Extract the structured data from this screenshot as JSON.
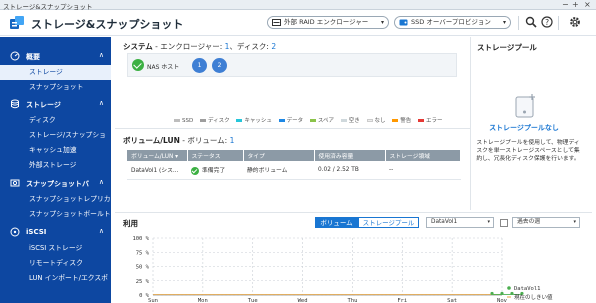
{
  "window": {
    "title": "ストレージ&スナップショット",
    "controls": [
      "−",
      "+",
      "×"
    ]
  },
  "header": {
    "app_title": "ストレージ&スナップショット",
    "raid_button": "外部 RAID エンクロージャー",
    "ssd_button": "SSD オーバープロビジョン"
  },
  "sidebar": {
    "sections": [
      {
        "label": "概要",
        "icon": "dashboard-icon",
        "items": [
          "ストレージ",
          "スナップショット"
        ]
      },
      {
        "label": "ストレージ",
        "icon": "database-icon",
        "items": [
          "ディスク",
          "ストレージ/スナップショ",
          "キャッシュ加速",
          "外部ストレージ"
        ]
      },
      {
        "label": "スナップショットバ",
        "icon": "snapshot-backup-icon",
        "items": [
          "スナップショットレプリカ",
          "スナップショットボールト"
        ]
      },
      {
        "label": "iSCSI",
        "icon": "iscsi-icon",
        "items": [
          "iSCSI ストレージ",
          "リモートディスク",
          "LUN インポート/エクスポ"
        ]
      }
    ],
    "selected": "ストレージ"
  },
  "system_panel": {
    "title": "システム",
    "enclosure_label": " - エンクロージャー: ",
    "enclosure_count": "1",
    "disk_label": "、ディスク: ",
    "disk_count": "2",
    "nas_host": "NAS ホスト",
    "disks": [
      "1",
      "2"
    ],
    "legend": [
      {
        "label": "SSD",
        "color": "#bdbdbd"
      },
      {
        "label": "ディスク",
        "color": "#9e9e9e"
      },
      {
        "label": "キャッシュ",
        "color": "#26c6da"
      },
      {
        "label": "データ",
        "color": "#1e88e5"
      },
      {
        "label": "スペア",
        "color": "#8bc34a"
      },
      {
        "label": "空き",
        "color": "#cfd8dc"
      },
      {
        "label": "なし",
        "color": "#eeeeee"
      },
      {
        "label": "警告",
        "color": "#ff9800"
      },
      {
        "label": "エラー",
        "color": "#e53935"
      }
    ]
  },
  "pool_panel": {
    "title": "ストレージプール",
    "none_label": "ストレージプールなし",
    "description": "ストレージプールを使用して、物理ディスクを単一ストレージスペースとして集約し、冗長化ディスク保護を行います。"
  },
  "volume_panel": {
    "title": "ボリューム/LUN",
    "count_label": " - ボリューム: ",
    "count": "1",
    "columns": [
      "ボリューム/LUN ▾",
      "ステータス",
      "タイプ",
      "使用済み容量",
      "ストレージ領域"
    ],
    "rows": [
      {
        "name": "DataVol1 (シス...",
        "status": "準備完了",
        "type": "静的ボリューム",
        "used": "0.02 / 2.52 TB",
        "area": "--"
      }
    ]
  },
  "usage_panel": {
    "title": "利用",
    "tab_volume": "ボリューム",
    "tab_pool": "ストレージプール",
    "volume_select": "DataVol1",
    "period_select": "過去の週",
    "legend_series": "DataVol1",
    "legend_threshold": "現在のしきい値"
  },
  "chart_data": {
    "type": "line",
    "categories": [
      "Sun",
      "Mon",
      "Tue",
      "Wed",
      "Thu",
      "Fri",
      "Sat",
      "Nov"
    ],
    "ytick_labels": [
      "100 %",
      "75 %",
      "50 %",
      "25 %",
      "0 %"
    ],
    "ylim": [
      0,
      100
    ],
    "grid": true,
    "series": [
      {
        "name": "DataVol1",
        "color": "#4caf50",
        "x": [
          6.8,
          7.0,
          7.2,
          7.4
        ],
        "values": [
          1,
          1,
          1,
          1
        ]
      }
    ],
    "threshold": {
      "name": "現在のしきい値",
      "value": 0
    },
    "legend_position": "right"
  }
}
